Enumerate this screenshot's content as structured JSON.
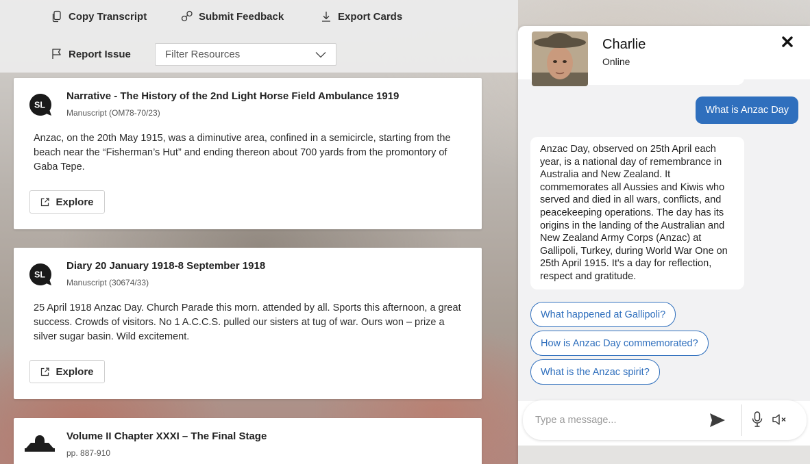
{
  "toolbar": {
    "copy_label": "Copy Transcript",
    "feedback_label": "Submit Feedback",
    "export_label": "Export Cards",
    "report_label": "Report Issue",
    "filter_placeholder": "Filter Resources"
  },
  "cards": [
    {
      "logo_text": "SL",
      "title": "Narrative - The History of the 2nd Light Horse Field Ambulance 1919",
      "subtitle": "Manuscript (OM78-70/23)",
      "body": "Anzac, on the 20th May 1915, was a diminutive area, confined in a semicircle, starting from the beach near the “Fisherman’s Hut” and ending thereon about 700 yards from the promontory of Gaba Tepe.",
      "button": "Explore"
    },
    {
      "logo_text": "SL",
      "title": "Diary 20 January 1918-8 September 1918",
      "subtitle": "Manuscript (30674/33)",
      "body": "25 April 1918 Anzac Day. Church Parade this morn. attended by all. Sports this afternoon, a great success. Crowds of visitors. No 1 A.C.C.S. pulled our sisters at tug of war. Ours won – prize a silver sugar basin. Wild excitement.",
      "button": "Explore"
    },
    {
      "title": "Volume II Chapter XXXI – The Final Stage",
      "subtitle": "pp. 887-910"
    }
  ],
  "chat": {
    "name": "Charlie",
    "status": "Online",
    "user_message": "What is Anzac Day",
    "bot_message": "Anzac Day, observed on 25th April each year, is a national day of remembrance in Australia and New Zealand. It commemorates all Aussies and Kiwis who served and died in all wars, conflicts, and peacekeeping operations. The day has its origins in the landing of the Australian and New Zealand Army Corps (Anzac) at Gallipoli, Turkey, during World War One on 25th April 1915. It's a day for reflection, respect and gratitude.",
    "suggestions": [
      "What happened at Gallipoli?",
      "How is Anzac Day commemorated?",
      "What is the Anzac spirit?"
    ],
    "input_placeholder": "Type a message..."
  },
  "colors": {
    "accent": "#2f6fbd",
    "card_background": "#ffffff",
    "chat_background": "#f2f2f3"
  },
  "icons": {
    "copy": "copy-icon",
    "feedback": "feedback-icon",
    "export": "download-icon",
    "report": "flag-icon",
    "dropdown": "chevron-down-icon",
    "explore": "external-link-icon",
    "close": "close-icon",
    "send": "send-icon",
    "mic": "microphone-icon",
    "mute": "speaker-muted-icon"
  }
}
